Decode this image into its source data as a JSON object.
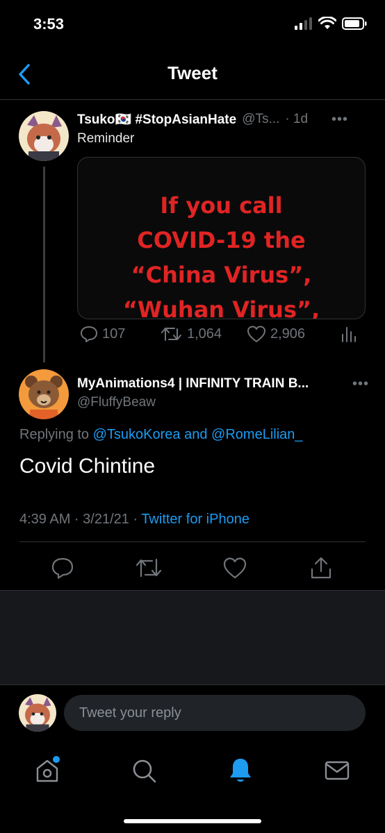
{
  "status_bar": {
    "time": "3:53"
  },
  "nav": {
    "title": "Tweet"
  },
  "parent_tweet": {
    "name": "Tsuko🇰🇷 #StopAsianHate",
    "handle": "@Ts...",
    "time": "· 1d",
    "text": "Reminder",
    "image_text": [
      "If you call",
      "COVID-19 the",
      "“China Virus”,",
      "“Wuhan Virus”,"
    ],
    "image_text_color": "#e02424",
    "replies": "107",
    "retweets": "1,064",
    "likes": "2,906"
  },
  "reply_tweet": {
    "name": "MyAnimations4 | INFINITY TRAIN B...",
    "handle": "@FluffyBeaw",
    "replying_prefix": "Replying to",
    "mention1": "@TsukoKorea",
    "and": "and",
    "mention2": "@RomeLilian_",
    "text": "Covid Chintine",
    "timestamp": "4:39 AM · 3/21/21 ·",
    "source": "Twitter for iPhone"
  },
  "composer": {
    "placeholder": "Tweet your reply"
  },
  "colors": {
    "accent": "#1d9bf0",
    "background": "#000000",
    "muted": "#71767b"
  }
}
